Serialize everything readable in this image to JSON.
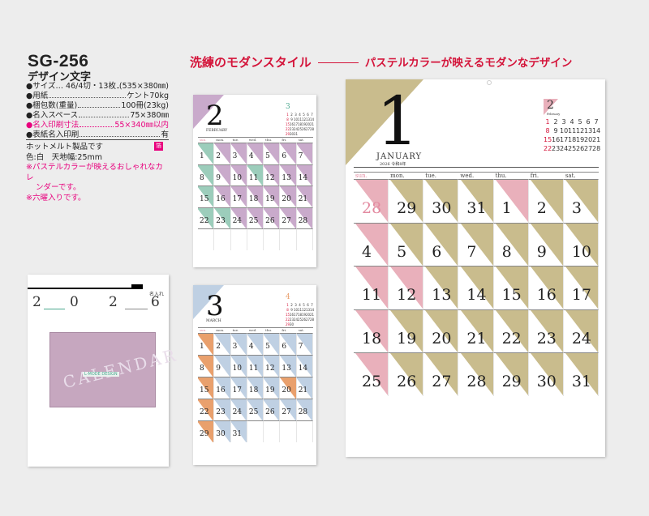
{
  "product": {
    "code": "SG-256",
    "name": "デザイン文字",
    "specs": [
      {
        "label": "●サイズ… 46/4切・13枚",
        "value": "(535×380㎜)",
        "color": "normal"
      },
      {
        "label": "●用紙",
        "value": "ケント70kg",
        "color": "normal"
      },
      {
        "label": "●梱包数(重量)",
        "value": "100冊(23kg)",
        "color": "normal"
      },
      {
        "label": "●名入スペース",
        "value": "75×380㎜",
        "color": "normal"
      },
      {
        "label": "●名入印刷寸法",
        "value": "55×340㎜以内",
        "color": "pink"
      },
      {
        "label": "●表紙名入印刷",
        "value": "有",
        "color": "normal"
      }
    ],
    "notes": {
      "hot_melt": "ホットメルト製品です",
      "binding": "色:白　天地幅:25mm",
      "foil_badge": "箔",
      "feature1": "※パステルカラーが映えるおしゃれなカレ",
      "feature1b": "ンダーです。",
      "feature2": "※六曜入りです。"
    }
  },
  "headline": {
    "main": "洗練のモダンスタイル",
    "sub": "パステルカラーが映えるモダンなデザイン"
  },
  "cover": {
    "year_digits": [
      "2",
      "0",
      "2",
      "6"
    ],
    "art_word": "CALENDAR",
    "art_tag": "L-MODE DESIGN",
    "brand": "名入れ"
  },
  "colors": {
    "pink": "#e9b0bb",
    "gold": "#c9bc8d",
    "purple": "#c9aacb",
    "teal": "#9ccdbb",
    "orange": "#e9a06d",
    "blue": "#bfd0e3",
    "accent_red": "#d4143a"
  },
  "weekdays": [
    "sun.",
    "mon.",
    "tue.",
    "wed.",
    "thu.",
    "fri.",
    "sat."
  ],
  "january": {
    "number": "1",
    "name": "JANUARY",
    "year_line": "2026 令和8年",
    "mini_number": "2",
    "mini_name": "February",
    "days": [
      [
        "28",
        "29",
        "30",
        "31",
        "1",
        "2",
        "3"
      ],
      [
        "4",
        "5",
        "6",
        "7",
        "8",
        "9",
        "10"
      ],
      [
        "11",
        "12",
        "13",
        "14",
        "15",
        "16",
        "17"
      ],
      [
        "18",
        "19",
        "20",
        "21",
        "22",
        "23",
        "24"
      ],
      [
        "25",
        "26",
        "27",
        "28",
        "29",
        "30",
        "31"
      ]
    ],
    "mini_days": [
      "1",
      "2",
      "3",
      "4",
      "5",
      "6",
      "7",
      "8",
      "9",
      "10",
      "11",
      "12",
      "13",
      "14",
      "15",
      "16",
      "17",
      "18",
      "19",
      "20",
      "21",
      "22",
      "23",
      "24",
      "25",
      "26",
      "27",
      "28"
    ]
  },
  "february": {
    "number": "2",
    "name": "FEBRUARY",
    "mini_number": "3",
    "days": [
      [
        "1",
        "2",
        "3",
        "4",
        "5",
        "6",
        "7"
      ],
      [
        "8",
        "9",
        "10",
        "11",
        "12",
        "13",
        "14"
      ],
      [
        "15",
        "16",
        "17",
        "18",
        "19",
        "20",
        "21"
      ],
      [
        "22",
        "23",
        "24",
        "25",
        "26",
        "27",
        "28"
      ],
      [
        "",
        "",
        "",
        "",
        "",
        "",
        ""
      ]
    ]
  },
  "march": {
    "number": "3",
    "name": "MARCH",
    "mini_number": "4",
    "days": [
      [
        "1",
        "2",
        "3",
        "4",
        "5",
        "6",
        "7"
      ],
      [
        "8",
        "9",
        "10",
        "11",
        "12",
        "13",
        "14"
      ],
      [
        "15",
        "16",
        "17",
        "18",
        "19",
        "20",
        "21"
      ],
      [
        "22",
        "23",
        "24",
        "25",
        "26",
        "27",
        "28"
      ],
      [
        "29",
        "30",
        "31",
        "",
        "",
        "",
        ""
      ]
    ]
  }
}
